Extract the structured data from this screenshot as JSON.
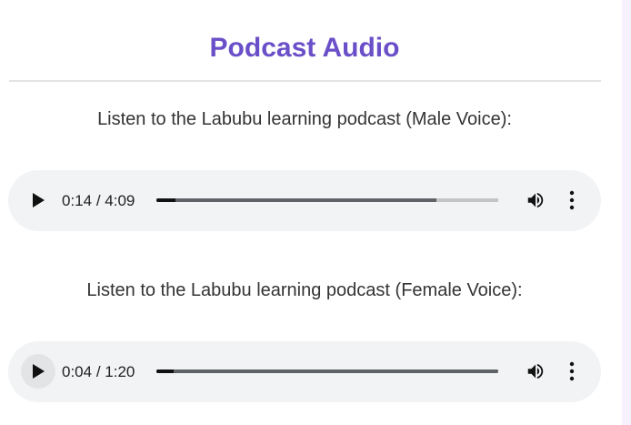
{
  "header": {
    "title": "Podcast Audio"
  },
  "players": [
    {
      "caption": "Listen to the Labubu learning podcast (Male Voice):",
      "current_time": "0:14",
      "separator": "/",
      "duration": "4:09",
      "played_fraction": 0.056,
      "buffered_fraction": 0.82,
      "play_icon": "play-icon",
      "volume_icon": "volume-icon",
      "menu_icon": "more-vertical-icon"
    },
    {
      "caption": "Listen to the Labubu learning podcast (Female Voice):",
      "current_time": "0:04",
      "separator": "/",
      "duration": "1:20",
      "played_fraction": 0.05,
      "buffered_fraction": 1.0,
      "play_icon": "play-icon",
      "volume_icon": "volume-icon",
      "menu_icon": "more-vertical-icon"
    }
  ],
  "colors": {
    "title": "#6a4fc8",
    "text": "#333333",
    "player_bg": "#f1f3f4"
  }
}
